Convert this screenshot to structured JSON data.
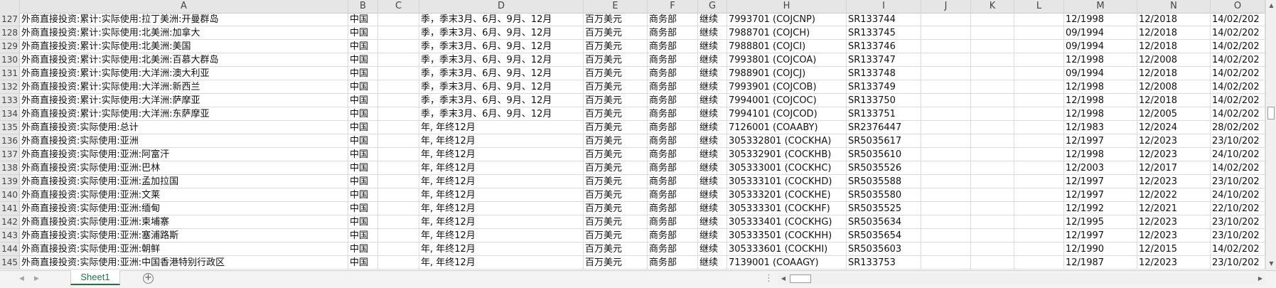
{
  "columns": [
    "A",
    "B",
    "C",
    "D",
    "E",
    "F",
    "G",
    "H",
    "I",
    "J",
    "K",
    "L",
    "M",
    "N",
    "O"
  ],
  "rows": [
    {
      "num": "127",
      "a": "外商直接投资:累计:实际使用:拉丁美洲:开曼群岛",
      "b": "中国",
      "c": "",
      "d": "季，季末3月、6月、9月、12月",
      "e": "百万美元",
      "f": "商务部",
      "g": "继续",
      "h": "7993701 (COJCNP)",
      "i": "SR133744",
      "j": "",
      "k": "",
      "l": "",
      "m": "12/1998",
      "n": "12/2018",
      "o": "14/02/202"
    },
    {
      "num": "128",
      "a": "外商直接投资:累计:实际使用:北美洲:加拿大",
      "b": "中国",
      "c": "",
      "d": "季，季末3月、6月、9月、12月",
      "e": "百万美元",
      "f": "商务部",
      "g": "继续",
      "h": "7988701 (COJCH)",
      "i": "SR133745",
      "j": "",
      "k": "",
      "l": "",
      "m": "09/1994",
      "n": "12/2018",
      "o": "14/02/202"
    },
    {
      "num": "129",
      "a": "外商直接投资:累计:实际使用:北美洲:美国",
      "b": "中国",
      "c": "",
      "d": "季，季末3月、6月、9月、12月",
      "e": "百万美元",
      "f": "商务部",
      "g": "继续",
      "h": "7988801 (COJCI)",
      "i": "SR133746",
      "j": "",
      "k": "",
      "l": "",
      "m": "09/1994",
      "n": "12/2018",
      "o": "14/02/202"
    },
    {
      "num": "130",
      "a": "外商直接投资:累计:实际使用:北美洲:百慕大群岛",
      "b": "中国",
      "c": "",
      "d": "季，季末3月、6月、9月、12月",
      "e": "百万美元",
      "f": "商务部",
      "g": "继续",
      "h": "7993801 (COJCOA)",
      "i": "SR133747",
      "j": "",
      "k": "",
      "l": "",
      "m": "12/1998",
      "n": "12/2008",
      "o": "14/02/202"
    },
    {
      "num": "131",
      "a": "外商直接投资:累计:实际使用:大洋洲:澳大利亚",
      "b": "中国",
      "c": "",
      "d": "季，季末3月、6月、9月、12月",
      "e": "百万美元",
      "f": "商务部",
      "g": "继续",
      "h": "7988901 (COJCJ)",
      "i": "SR133748",
      "j": "",
      "k": "",
      "l": "",
      "m": "09/1994",
      "n": "12/2018",
      "o": "14/02/202"
    },
    {
      "num": "132",
      "a": "外商直接投资:累计:实际使用:大洋洲:新西兰",
      "b": "中国",
      "c": "",
      "d": "季，季末3月、6月、9月、12月",
      "e": "百万美元",
      "f": "商务部",
      "g": "继续",
      "h": "7993901 (COJCOB)",
      "i": "SR133749",
      "j": "",
      "k": "",
      "l": "",
      "m": "12/1998",
      "n": "12/2008",
      "o": "14/02/202"
    },
    {
      "num": "133",
      "a": "外商直接投资:累计:实际使用:大洋洲:萨摩亚",
      "b": "中国",
      "c": "",
      "d": "季，季末3月、6月、9月、12月",
      "e": "百万美元",
      "f": "商务部",
      "g": "继续",
      "h": "7994001 (COJCOC)",
      "i": "SR133750",
      "j": "",
      "k": "",
      "l": "",
      "m": "12/1998",
      "n": "12/2018",
      "o": "14/02/202"
    },
    {
      "num": "134",
      "a": "外商直接投资:累计:实际使用:大洋洲:东萨摩亚",
      "b": "中国",
      "c": "",
      "d": "季，季末3月、6月、9月、12月",
      "e": "百万美元",
      "f": "商务部",
      "g": "继续",
      "h": "7994101 (COJCOD)",
      "i": "SR133751",
      "j": "",
      "k": "",
      "l": "",
      "m": "12/1998",
      "n": "12/2005",
      "o": "14/02/202"
    },
    {
      "num": "135",
      "a": "外商直接投资:实际使用:总计",
      "b": "中国",
      "c": "",
      "d": "年, 年终12月",
      "e": "百万美元",
      "f": "商务部",
      "g": "继续",
      "h": "7126001 (COAABY)",
      "i": "SR2376447",
      "j": "",
      "k": "",
      "l": "",
      "m": "12/1983",
      "n": "12/2024",
      "o": "28/02/202"
    },
    {
      "num": "136",
      "a": "外商直接投资:实际使用:亚洲",
      "b": "中国",
      "c": "",
      "d": "年, 年终12月",
      "e": "百万美元",
      "f": "商务部",
      "g": "继续",
      "h": "305332801 (COCKHA)",
      "i": "SR5035617",
      "j": "",
      "k": "",
      "l": "",
      "m": "12/1997",
      "n": "12/2023",
      "o": "23/10/202"
    },
    {
      "num": "137",
      "a": "外商直接投资:实际使用:亚洲:阿富汗",
      "b": "中国",
      "c": "",
      "d": "年, 年终12月",
      "e": "百万美元",
      "f": "商务部",
      "g": "继续",
      "h": "305332901 (COCKHB)",
      "i": "SR5035610",
      "j": "",
      "k": "",
      "l": "",
      "m": "12/1998",
      "n": "12/2023",
      "o": "24/10/202"
    },
    {
      "num": "138",
      "a": "外商直接投资:实际使用:亚洲:巴林",
      "b": "中国",
      "c": "",
      "d": "年, 年终12月",
      "e": "百万美元",
      "f": "商务部",
      "g": "继续",
      "h": "305333001 (COCKHC)",
      "i": "SR5035526",
      "j": "",
      "k": "",
      "l": "",
      "m": "12/2003",
      "n": "12/2017",
      "o": "14/02/202"
    },
    {
      "num": "139",
      "a": "外商直接投资:实际使用:亚洲:孟加拉国",
      "b": "中国",
      "c": "",
      "d": "年, 年终12月",
      "e": "百万美元",
      "f": "商务部",
      "g": "继续",
      "h": "305333101 (COCKHD)",
      "i": "SR5035588",
      "j": "",
      "k": "",
      "l": "",
      "m": "12/1997",
      "n": "12/2023",
      "o": "23/10/202"
    },
    {
      "num": "140",
      "a": "外商直接投资:实际使用:亚洲:文莱",
      "b": "中国",
      "c": "",
      "d": "年, 年终12月",
      "e": "百万美元",
      "f": "商务部",
      "g": "继续",
      "h": "305333201 (COCKHE)",
      "i": "SR5035580",
      "j": "",
      "k": "",
      "l": "",
      "m": "12/1997",
      "n": "12/2022",
      "o": "24/10/202"
    },
    {
      "num": "141",
      "a": "外商直接投资:实际使用:亚洲:缅甸",
      "b": "中国",
      "c": "",
      "d": "年, 年终12月",
      "e": "百万美元",
      "f": "商务部",
      "g": "继续",
      "h": "305333301 (COCKHF)",
      "i": "SR5035525",
      "j": "",
      "k": "",
      "l": "",
      "m": "12/1992",
      "n": "12/2021",
      "o": "22/10/202"
    },
    {
      "num": "142",
      "a": "外商直接投资:实际使用:亚洲:柬埔寨",
      "b": "中国",
      "c": "",
      "d": "年, 年终12月",
      "e": "百万美元",
      "f": "商务部",
      "g": "继续",
      "h": "305333401 (COCKHG)",
      "i": "SR5035634",
      "j": "",
      "k": "",
      "l": "",
      "m": "12/1995",
      "n": "12/2023",
      "o": "23/10/202"
    },
    {
      "num": "143",
      "a": "外商直接投资:实际使用:亚洲:塞浦路斯",
      "b": "中国",
      "c": "",
      "d": "年, 年终12月",
      "e": "百万美元",
      "f": "商务部",
      "g": "继续",
      "h": "305333501 (COCKHH)",
      "i": "SR5035654",
      "j": "",
      "k": "",
      "l": "",
      "m": "12/1997",
      "n": "12/2023",
      "o": "23/10/202"
    },
    {
      "num": "144",
      "a": "外商直接投资:实际使用:亚洲:朝鲜",
      "b": "中国",
      "c": "",
      "d": "年, 年终12月",
      "e": "百万美元",
      "f": "商务部",
      "g": "继续",
      "h": "305333601 (COCKHI)",
      "i": "SR5035603",
      "j": "",
      "k": "",
      "l": "",
      "m": "12/1990",
      "n": "12/2015",
      "o": "14/02/202"
    },
    {
      "num": "145",
      "a": "外商直接投资:实际使用:亚洲:中国香港特别行政区",
      "b": "中国",
      "c": "",
      "d": "年, 年终12月",
      "e": "百万美元",
      "f": "商务部",
      "g": "继续",
      "h": "7139001 (COAAGY)",
      "i": "SR133753",
      "j": "",
      "k": "",
      "l": "",
      "m": "12/1987",
      "n": "12/2023",
      "o": "23/10/202"
    }
  ],
  "sheet_tabs": [
    {
      "label": "Sheet1",
      "active": true
    }
  ],
  "add_sheet_glyph": "+",
  "more_glyph": "⋮",
  "icons": {
    "scroll_up": "triangle-up-icon",
    "scroll_down": "triangle-down-icon",
    "scroll_left": "triangle-left-icon",
    "scroll_right": "triangle-right-icon",
    "sheet_prev": "sheet-prev-icon",
    "sheet_next": "sheet-next-icon",
    "add_sheet": "plus-circle-icon"
  },
  "colors": {
    "accent": "#217346",
    "header_bg": "#e6e6e6",
    "grid_line": "#dadada"
  }
}
